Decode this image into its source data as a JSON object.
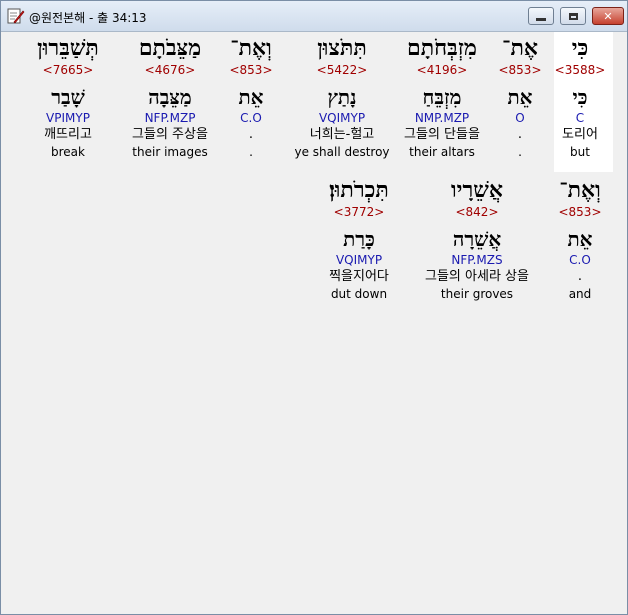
{
  "window": {
    "title": "@원전본해 - 출 34:13",
    "minimize_label": "",
    "maximize_label": "",
    "close_label": "✕"
  },
  "words": [
    {
      "hebrew": "כִּי",
      "strong": "<3588>",
      "root": "כִּי",
      "morph": "C",
      "korean": "도리어",
      "english": "but"
    },
    {
      "hebrew": "אֶת־",
      "strong": "<853>",
      "root": "אֵת",
      "morph": "O",
      "korean": ".",
      "english": "."
    },
    {
      "hebrew": "מִזְבְּחֹתָם",
      "strong": "<4196>",
      "root": "מִזְבֵּחַ",
      "morph": "NMP.MZP",
      "korean": "그들의 단들을",
      "english": "their altars"
    },
    {
      "hebrew": "תִּתֹּצוּן",
      "strong": "<5422>",
      "root": "נָתַץ",
      "morph": "VQIMYP",
      "korean": "너희는-헐고",
      "english": "ye shall destroy"
    },
    {
      "hebrew": "וְאֶת־",
      "strong": "<853>",
      "root": "אֵת",
      "morph": "C.O",
      "korean": ".",
      "english": "."
    },
    {
      "hebrew": "מַצֵּבֹתָם",
      "strong": "<4676>",
      "root": "מַצֵּבָה",
      "morph": "NFP.MZP",
      "korean": "그들의 주상을",
      "english": "their images"
    },
    {
      "hebrew": "תְּשַׁבֵּרוּן",
      "strong": "<7665>",
      "root": "שָׁבַר",
      "morph": "VPIMYP",
      "korean": "깨뜨리고",
      "english": "break"
    },
    {
      "hebrew": "וְאֶת־",
      "strong": "<853>",
      "root": "אֵת",
      "morph": "C.O",
      "korean": ".",
      "english": "and"
    },
    {
      "hebrew": "אֲשֵׁרָיו",
      "strong": "<842>",
      "root": "אֲשֵׁרָה",
      "morph": "NFP.MZS",
      "korean": "그들의 아세라 상을",
      "english": "their groves"
    },
    {
      "hebrew": "תִּכְרֹתוּן׃",
      "strong": "<3772>",
      "root": "כָּרַת",
      "morph": "VQIMYP",
      "korean": "찍을지어다",
      "english": "dut down"
    }
  ]
}
